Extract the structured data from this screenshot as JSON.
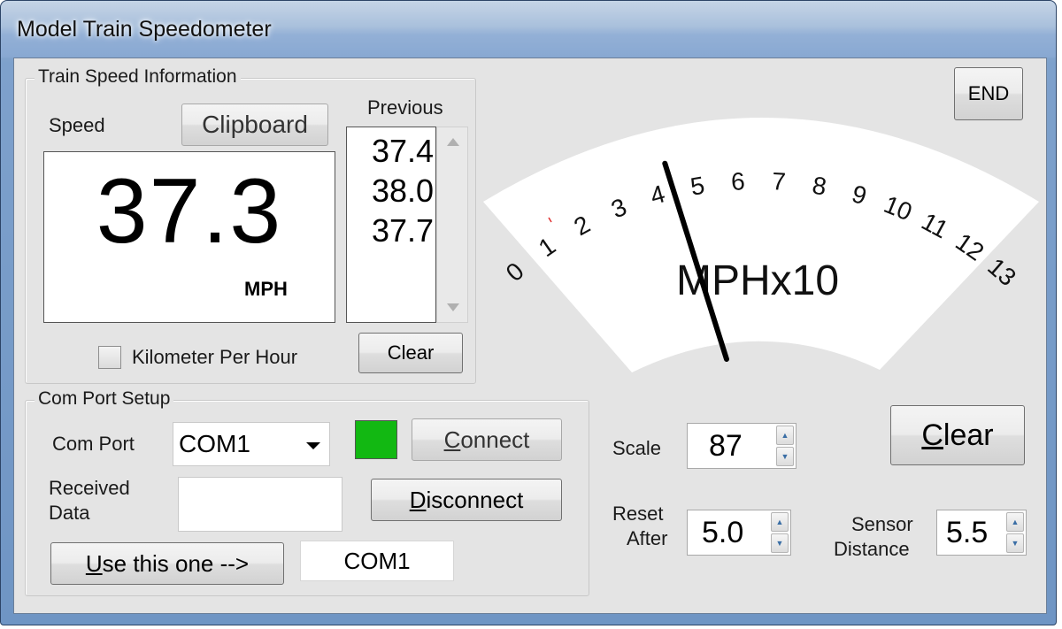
{
  "window": {
    "title": "Model Train Speedometer"
  },
  "speed_group": {
    "title": "Train Speed Information",
    "speed_label": "Speed",
    "clipboard_label": "Clipboard",
    "speed_value": "37.3",
    "unit": "MPH",
    "previous_label": "Previous",
    "previous_values": [
      "37.4",
      "38.0",
      "37.7"
    ],
    "kph_label": "Kilometer Per Hour",
    "kph_checked": false,
    "clear_label": "Clear"
  },
  "gauge": {
    "ticks": [
      "0",
      "1",
      "2",
      "3",
      "4",
      "5",
      "6",
      "7",
      "8",
      "9",
      "10",
      "11",
      "12",
      "13"
    ],
    "unit_label": "MPHx10",
    "needle_value": 3.73
  },
  "end_label": "END",
  "com_group": {
    "title": "Com Port Setup",
    "com_port_label": "Com Port",
    "com_port_value": "COM1",
    "connect_label": "Connect",
    "connect_accel": "C",
    "connect_rest": "onnect",
    "status_color": "#12b812",
    "received_label_1": "Received",
    "received_label_2": "Data",
    "received_value": "",
    "disconnect_accel": "D",
    "disconnect_rest": "isconnect",
    "use_accel": "U",
    "use_rest": "se this one -->",
    "selected_port": "COM1"
  },
  "settings": {
    "scale_label": "Scale",
    "scale_value": "87",
    "reset_label_1": "Reset",
    "reset_label_2": "After",
    "reset_value": "5.0",
    "sensor_label_1": "Sensor",
    "sensor_label_2": "Distance",
    "sensor_value": "5.5",
    "clear_accel": "C",
    "clear_rest": "lear"
  }
}
